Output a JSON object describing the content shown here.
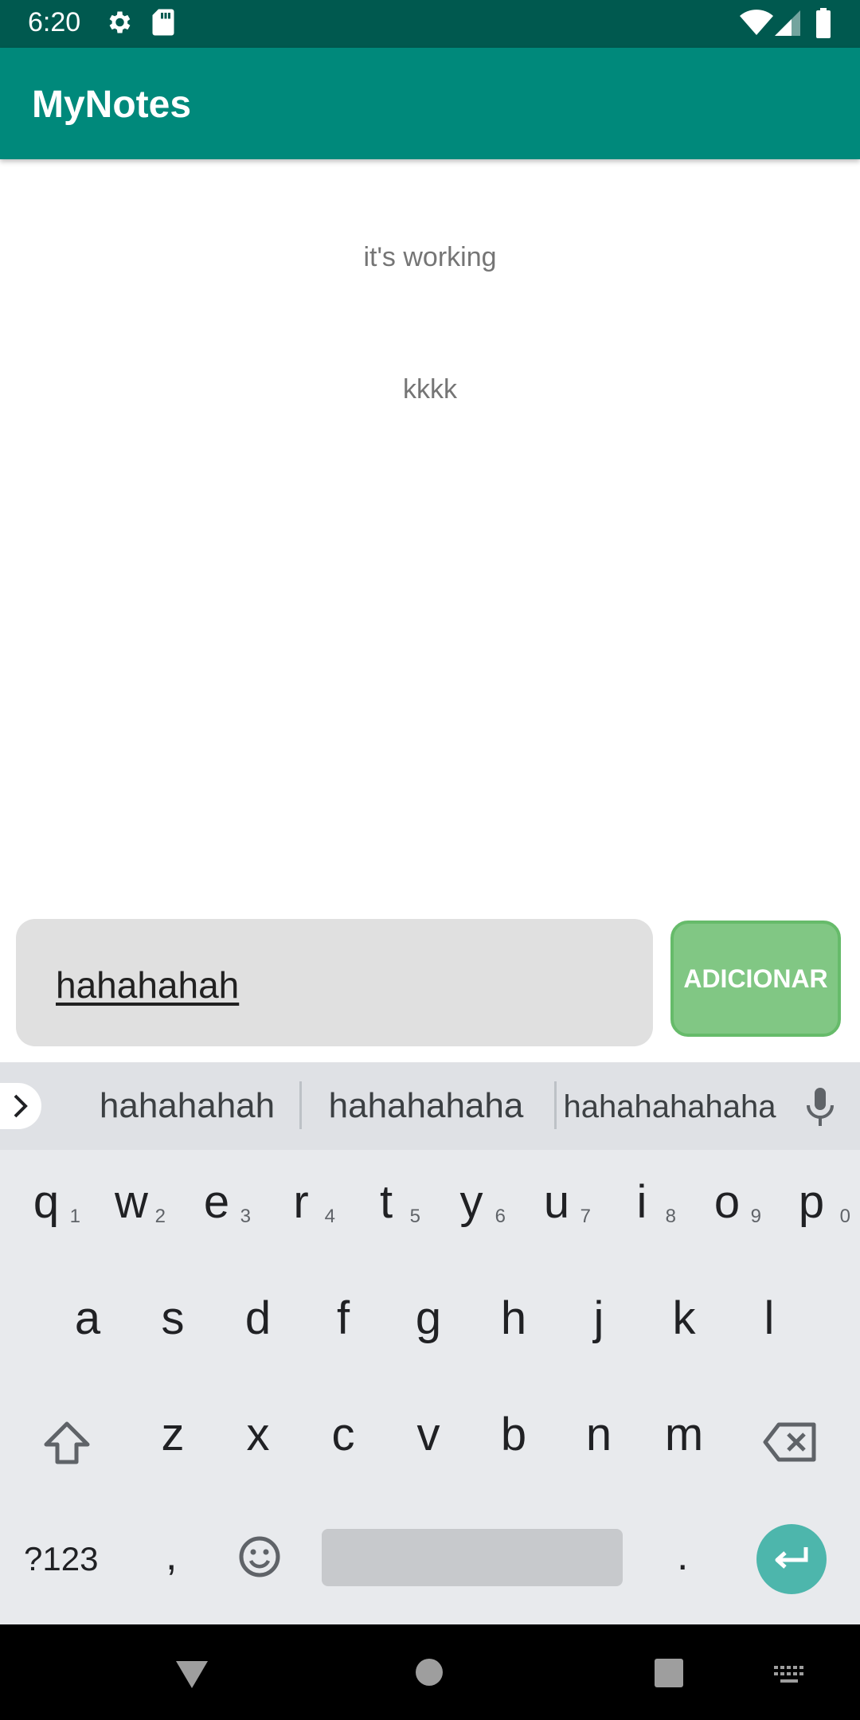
{
  "status_bar": {
    "time": "6:20",
    "icons": [
      "gear-icon",
      "sd-card-icon",
      "wifi-icon",
      "signal-icon",
      "battery-icon"
    ]
  },
  "app_bar": {
    "title": "MyNotes",
    "color": "#00897b"
  },
  "notes": [
    {
      "text": "it's working"
    },
    {
      "text": "kkkk"
    }
  ],
  "input": {
    "value": "hahahahah"
  },
  "add_button": {
    "label": "ADICIONAR",
    "color": "#81c784"
  },
  "keyboard": {
    "suggestions": [
      "hahahahah",
      "hahahahaha",
      "hahahahahaha"
    ],
    "row1": [
      {
        "key": "q",
        "num": "1"
      },
      {
        "key": "w",
        "num": "2"
      },
      {
        "key": "e",
        "num": "3"
      },
      {
        "key": "r",
        "num": "4"
      },
      {
        "key": "t",
        "num": "5"
      },
      {
        "key": "y",
        "num": "6"
      },
      {
        "key": "u",
        "num": "7"
      },
      {
        "key": "i",
        "num": "8"
      },
      {
        "key": "o",
        "num": "9"
      },
      {
        "key": "p",
        "num": "0"
      }
    ],
    "row2": [
      "a",
      "s",
      "d",
      "f",
      "g",
      "h",
      "j",
      "k",
      "l"
    ],
    "row3": [
      "z",
      "x",
      "c",
      "v",
      "b",
      "n",
      "m"
    ],
    "symbols_label": "?123",
    "comma": ",",
    "period": ".",
    "enter_color": "#4db6ac"
  },
  "nav_bar": {
    "icons": [
      "back-icon",
      "home-icon",
      "recents-icon",
      "keyboard-switch-icon"
    ]
  }
}
